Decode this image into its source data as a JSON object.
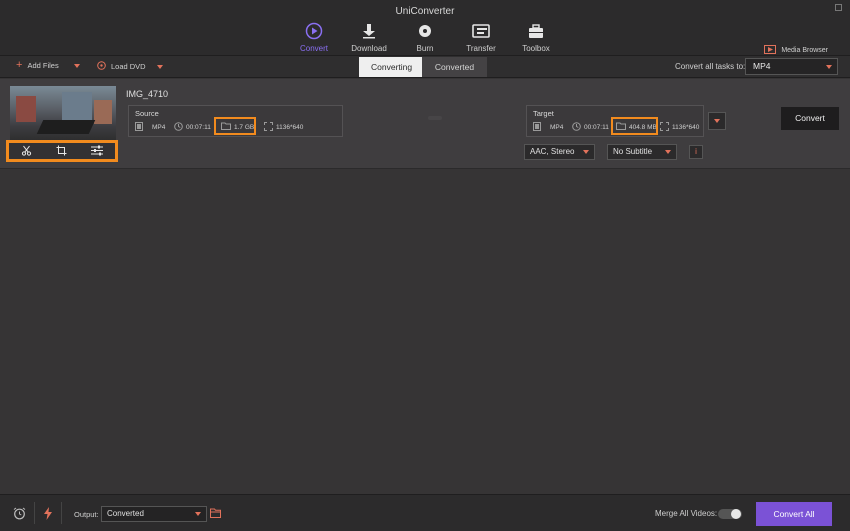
{
  "app": {
    "title": "UniConverter"
  },
  "nav": [
    {
      "label": "Convert",
      "icon": "convert-icon"
    },
    {
      "label": "Download",
      "icon": "download-icon"
    },
    {
      "label": "Burn",
      "icon": "burn-icon"
    },
    {
      "label": "Transfer",
      "icon": "transfer-icon"
    },
    {
      "label": "Toolbox",
      "icon": "toolbox-icon"
    }
  ],
  "media_browser": {
    "label": "Media Browser"
  },
  "toolbar": {
    "add_files": "Add Files",
    "load_dvd": "Load DVD",
    "tabs": [
      "Converting",
      "Converted"
    ],
    "convert_all_label": "Convert all tasks to:",
    "convert_all_format": "MP4"
  },
  "task": {
    "name": "IMG_4710",
    "source": {
      "title": "Source",
      "format": "MP4",
      "duration": "00:07:11",
      "size": "1.7 GB",
      "resolution": "1136*640"
    },
    "target": {
      "title": "Target",
      "format": "MP4",
      "duration": "00:07:11",
      "size": "404.8 MB",
      "resolution": "1136*640"
    },
    "audio": "AAC, Stereo",
    "subtitle": "No Subtitle",
    "convert_label": "Convert"
  },
  "bottom": {
    "output_label": "Output:",
    "output_value": "Converted",
    "merge_label": "Merge All Videos:",
    "merge_on": false,
    "convert_all": "Convert All"
  },
  "colors": {
    "accent": "#7b52d6",
    "highlight": "#f28b1e",
    "caret": "#e2725b"
  }
}
